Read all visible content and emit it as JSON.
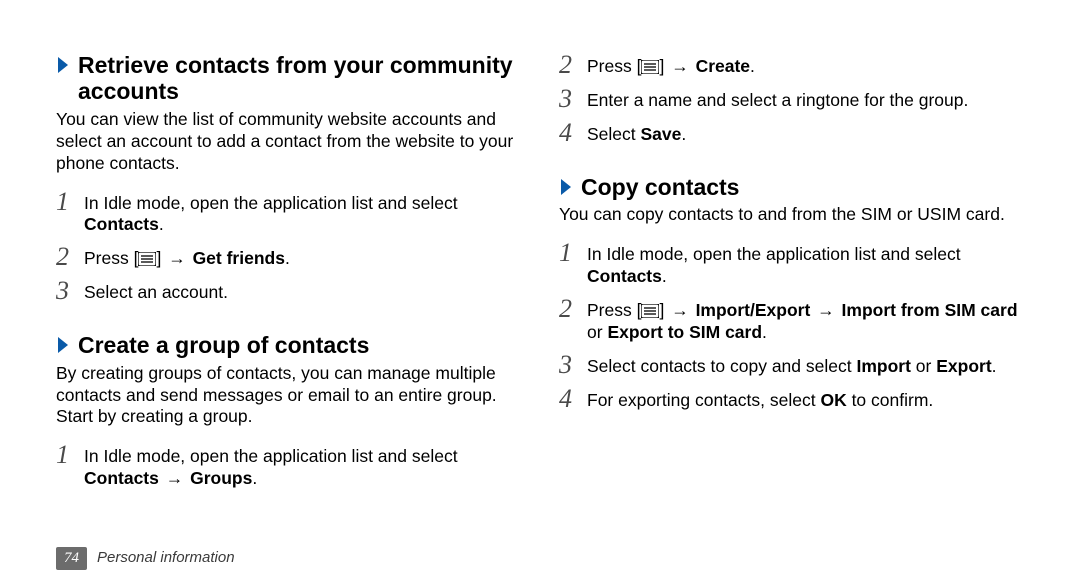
{
  "left": {
    "sec1": {
      "heading": "Retrieve contacts from your community accounts",
      "para": "You can view the list of community website accounts and select an account to add a contact from the website to your phone contacts.",
      "step1a": "In Idle mode, open the application list and select ",
      "step1b": "Contacts",
      "step1c": ".",
      "step2a": "Press [",
      "step2b": "] ",
      "step2arrow": "→",
      "step2c": " Get friends",
      "step2d": ".",
      "step3": "Select an account."
    },
    "sec2": {
      "heading": "Create a group of contacts",
      "para": "By creating groups of contacts, you can manage multiple contacts and send messages or email to an entire group. Start by creating a group.",
      "step1a": "In Idle mode, open the application list and select ",
      "step1b": "Contacts",
      "step1arrow": " → ",
      "step1c": "Groups",
      "step1d": "."
    }
  },
  "right": {
    "cont": {
      "step2a": "Press [",
      "step2b": "] ",
      "step2arrow": "→",
      "step2c": " Create",
      "step2d": ".",
      "step3": "Enter a name and select a ringtone for the group.",
      "step4a": "Select ",
      "step4b": "Save",
      "step4c": "."
    },
    "sec3": {
      "heading": "Copy contacts",
      "para": "You can copy contacts to and from the SIM or USIM card.",
      "step1a": "In Idle mode, open the application list and select ",
      "step1b": "Contacts",
      "step1c": ".",
      "step2a": "Press [",
      "step2b": "] ",
      "step2arrow": "→",
      "step2c": " Import/Export",
      "step2arrow2": " → ",
      "step2d": "Import from SIM card",
      "step2e": " or ",
      "step2f": "Export to SIM card",
      "step2g": ".",
      "step3a": "Select contacts to copy and select ",
      "step3b": "Import",
      "step3c": " or ",
      "step3d": "Export",
      "step3e": ".",
      "step4a": "For exporting contacts, select ",
      "step4b": "OK",
      "step4c": " to confirm."
    }
  },
  "nums": {
    "n1": "1",
    "n2": "2",
    "n3": "3",
    "n4": "4"
  },
  "footer": {
    "page": "74",
    "section": "Personal information"
  }
}
